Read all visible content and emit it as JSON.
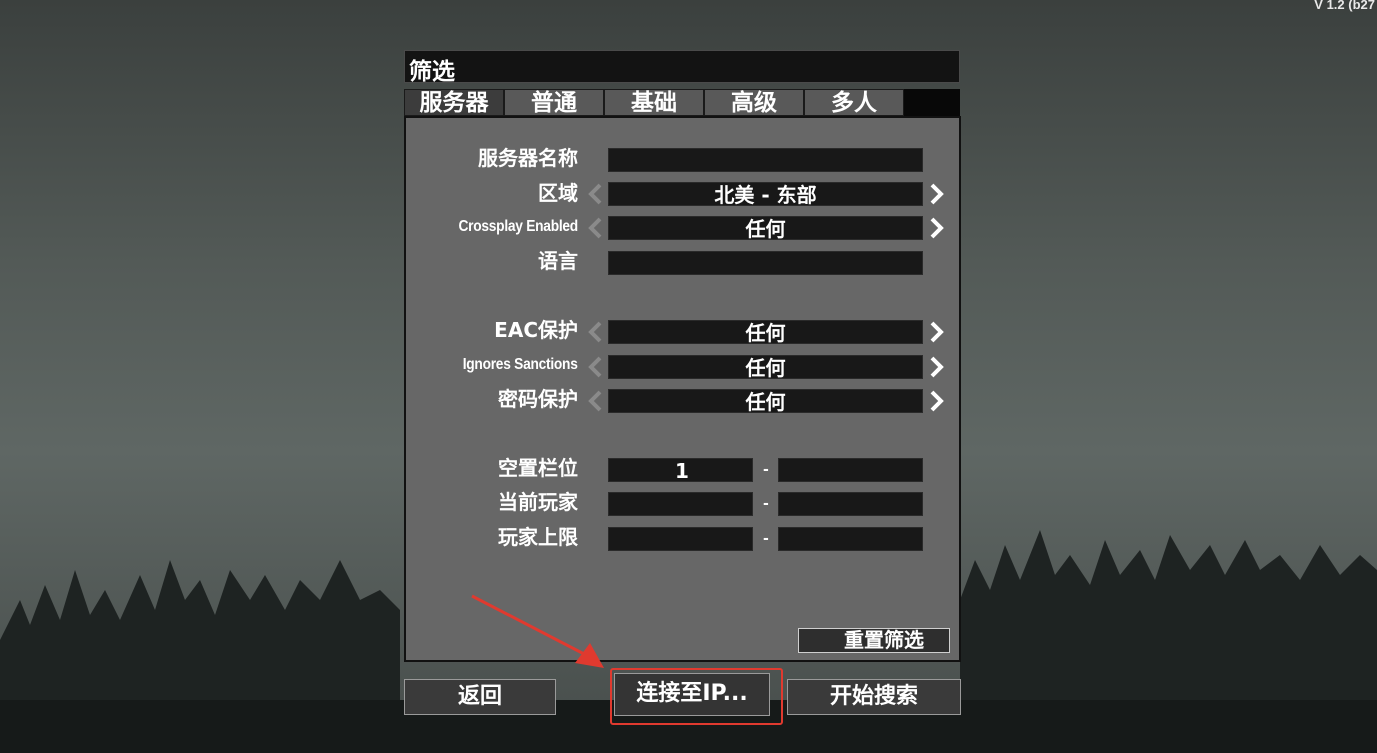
{
  "version": "V 1.2 (b27",
  "title": "筛选",
  "tabs": [
    {
      "label": "服务器",
      "active": true
    },
    {
      "label": "普通",
      "active": false
    },
    {
      "label": "基础",
      "active": false
    },
    {
      "label": "高级",
      "active": false
    },
    {
      "label": "多人",
      "active": false
    }
  ],
  "rows": {
    "server_name": {
      "label": "服务器名称",
      "value": ""
    },
    "region": {
      "label": "区域",
      "value": "北美 - 东部"
    },
    "crossplay": {
      "label": "Crossplay Enabled",
      "value": "任何"
    },
    "language": {
      "label": "语言",
      "value": ""
    },
    "eac": {
      "label": "EAC保护",
      "value": "任何"
    },
    "sanctions": {
      "label": "Ignores Sanctions",
      "value": "任何"
    },
    "password": {
      "label": "密码保护",
      "value": "任何"
    },
    "free_slots": {
      "label": "空置栏位",
      "min": "1",
      "max": "",
      "sep": "-"
    },
    "current_players": {
      "label": "当前玩家",
      "min": "",
      "max": "",
      "sep": "-"
    },
    "max_players": {
      "label": "玩家上限",
      "min": "",
      "max": "",
      "sep": "-"
    }
  },
  "buttons": {
    "reset": "重置筛选",
    "back": "返回",
    "connect_ip": "连接至IP...",
    "start_search": "开始搜索"
  },
  "colors": {
    "highlight": "#e03a2f",
    "panel": "#676767",
    "field": "#181818",
    "active_tab": "#3c3c3c"
  },
  "icons": {
    "left_arrow": "chevron-left-icon",
    "right_arrow": "chevron-right-icon"
  }
}
